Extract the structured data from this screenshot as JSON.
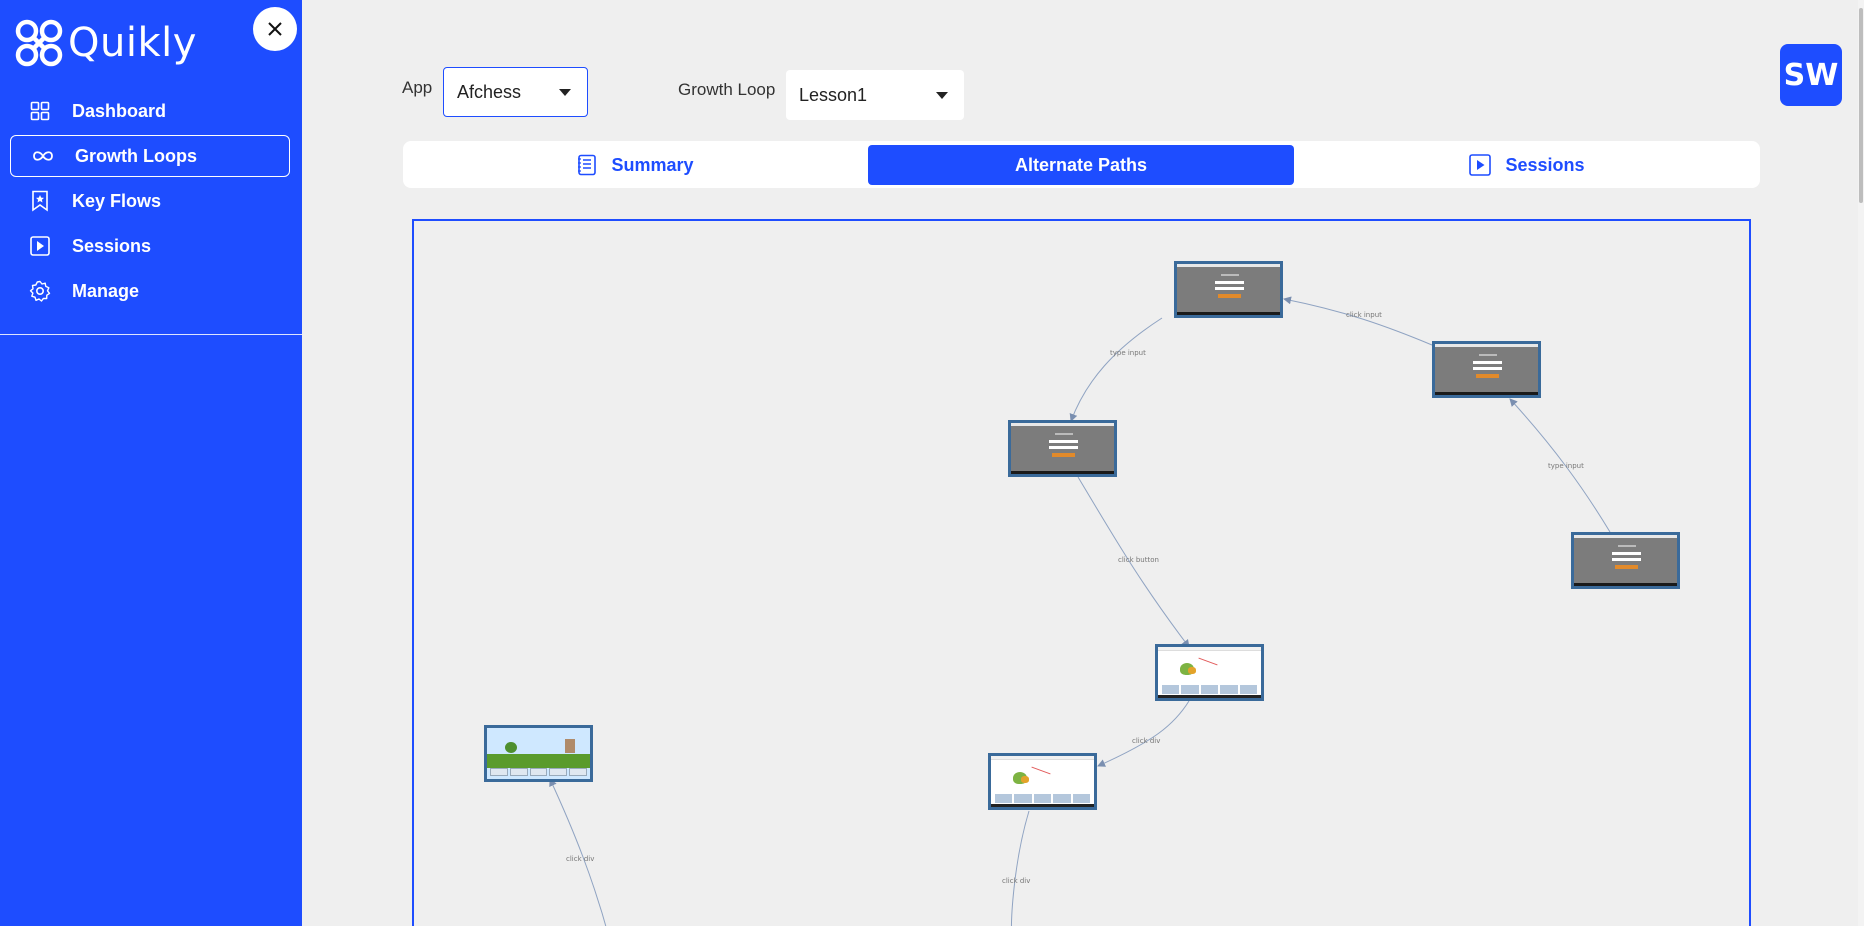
{
  "app": {
    "name": "Quikly"
  },
  "sidebar": {
    "items": [
      {
        "label": "Dashboard",
        "icon": "grid-icon",
        "active": false
      },
      {
        "label": "Growth Loops",
        "icon": "infinity-icon",
        "active": true
      },
      {
        "label": "Key Flows",
        "icon": "bookmark-icon",
        "active": false
      },
      {
        "label": "Sessions",
        "icon": "play-icon",
        "active": false
      },
      {
        "label": "Manage",
        "icon": "gear-icon",
        "active": false
      }
    ]
  },
  "filters": {
    "app_label": "App",
    "app_value": "Afchess",
    "loop_label": "Growth Loop",
    "loop_value": "Lesson1"
  },
  "user": {
    "initials": "SW"
  },
  "tabs": [
    {
      "label": "Summary",
      "icon": "document-icon",
      "active": false
    },
    {
      "label": "Alternate Paths",
      "active": true
    },
    {
      "label": "Sessions",
      "icon": "play-icon",
      "active": false
    }
  ],
  "graph": {
    "edge_labels": [
      "type input",
      "click input",
      "type input",
      "click button",
      "click div",
      "click div",
      "click div"
    ]
  },
  "colors": {
    "brand": "#1e4dff",
    "node_border": "#3a6a9a",
    "background": "#efefef"
  }
}
